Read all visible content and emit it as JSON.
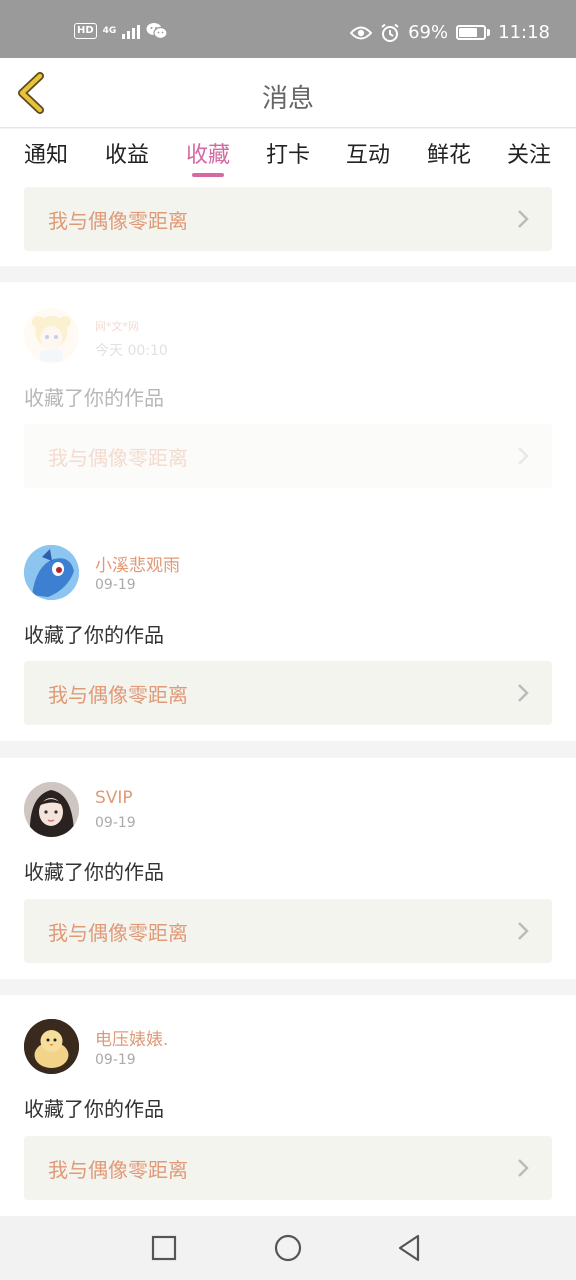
{
  "status_bar": {
    "hd": "HD",
    "network": "4G",
    "battery_percent": "69%",
    "time": "11:18",
    "icons": [
      "hd-icon",
      "signal-icon",
      "wechat-icon",
      "eye-icon",
      "alarm-icon",
      "battery-icon"
    ]
  },
  "header": {
    "title": "消息",
    "back_icon": "chevron-left-icon"
  },
  "tabs": [
    {
      "label": "通知",
      "active": false
    },
    {
      "label": "收益",
      "active": false
    },
    {
      "label": "收藏",
      "active": true
    },
    {
      "label": "打卡",
      "active": false
    },
    {
      "label": "互动",
      "active": false
    },
    {
      "label": "鲜花",
      "active": false
    },
    {
      "label": "关注",
      "active": false
    }
  ],
  "feed": [
    {
      "work_title": "我与偶像零距离"
    },
    {
      "user": "网*文*网",
      "time": "今天 00:10",
      "action": "收藏了你的作品",
      "work_title": "我与偶像零距离",
      "faded": true
    },
    {
      "user": "小溪悲观雨",
      "time": "09-19",
      "action": "收藏了你的作品",
      "work_title": "我与偶像零距离"
    },
    {
      "user": "SVIP",
      "time": "09-19",
      "action": "收藏了你的作品",
      "work_title": "我与偶像零距离"
    },
    {
      "user": "电压婊婊.",
      "time": "09-19",
      "action": "收藏了你的作品",
      "work_title": "我与偶像零距离"
    }
  ],
  "colors": {
    "accent": "#d46aa2",
    "username": "#e09a78",
    "back_arrow": "#e8c23a"
  },
  "nav": {
    "icons": [
      "recent-apps-icon",
      "home-icon",
      "back-icon"
    ]
  }
}
